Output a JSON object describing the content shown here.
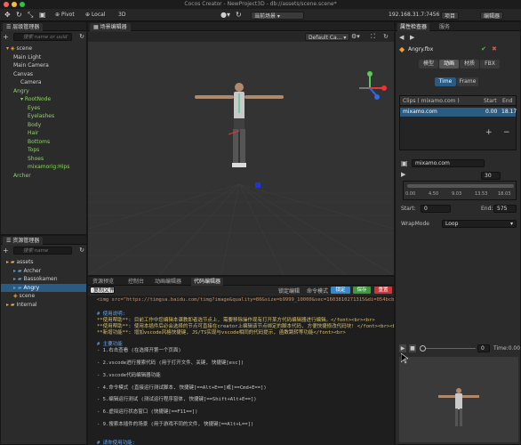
{
  "window": {
    "title": "Cocos Creator - NewProject3D - db://assets/scene.scene*"
  },
  "toolbar": {
    "pivot": "Pivot",
    "local": "Local",
    "mode3d": "3D",
    "scene_select": "当前场景",
    "ip": "192.168.31.7:7456",
    "project_btn": "项目",
    "editor_btn": "编辑器"
  },
  "hierarchy": {
    "tab": "层级管理器",
    "search_placeholder": "搜索 name or uuid",
    "nodes": [
      {
        "label": "scene",
        "depth": 0,
        "color": "normal"
      },
      {
        "label": "Main Light",
        "depth": 1,
        "color": "normal"
      },
      {
        "label": "Main Camera",
        "depth": 1,
        "color": "normal"
      },
      {
        "label": "Canvas",
        "depth": 1,
        "color": "normal"
      },
      {
        "label": "Camera",
        "depth": 2,
        "color": "normal"
      },
      {
        "label": "Angry",
        "depth": 1,
        "color": "green"
      },
      {
        "label": "RootNode",
        "depth": 2,
        "color": "green"
      },
      {
        "label": "Eyes",
        "depth": 3,
        "color": "green"
      },
      {
        "label": "Eyelashes",
        "depth": 3,
        "color": "green"
      },
      {
        "label": "Body",
        "depth": 3,
        "color": "green"
      },
      {
        "label": "Hair",
        "depth": 3,
        "color": "green"
      },
      {
        "label": "Bottoms",
        "depth": 3,
        "color": "green"
      },
      {
        "label": "Tops",
        "depth": 3,
        "color": "green"
      },
      {
        "label": "Shoes",
        "depth": 3,
        "color": "green"
      },
      {
        "label": "mixamorig:Hips",
        "depth": 3,
        "color": "green"
      },
      {
        "label": "Archer",
        "depth": 1,
        "color": "green"
      }
    ]
  },
  "assets": {
    "tab": "资源管理器",
    "search_placeholder": "搜索 name",
    "nodes": [
      {
        "label": "assets",
        "depth": 0,
        "sel": false
      },
      {
        "label": "Archer",
        "depth": 1,
        "sel": false
      },
      {
        "label": "Bassokamen",
        "depth": 1,
        "sel": false
      },
      {
        "label": "Angry",
        "depth": 1,
        "sel": true
      },
      {
        "label": "scene",
        "depth": 1,
        "sel": false
      },
      {
        "label": "Internal",
        "depth": 0,
        "sel": false
      }
    ]
  },
  "scene": {
    "tab": "场景编辑器",
    "camera_select": "Default Ca..."
  },
  "bottom": {
    "tabs": [
      "资源预览",
      "控制台",
      "动画编辑器",
      "代码编辑器"
    ],
    "file_select": "复制文件",
    "lock_label": "锁定编辑",
    "mode_label": "命令模式",
    "btn_save": "保存",
    "btn_run": "刷新",
    "btn_close": "重置",
    "code_lines": [
      "<img src=\"https://timgsa.baidu.com/timg?image&quality=80&size=b9999_10000&sec=1603810271315&di=054bcb72cf7f0fa1a0e0",
      "",
      "# 使用说明:",
      "**使用帮助**: 目前工作中您编辑本课教即者选节点上, 需要移除操作现有打开某方代码编辑器进行编辑。</font><br><br>",
      "**使用帮助**: 使用本插件后必会选择的节点可直接在creator上编辑该节点绑定的脚本代码, 方便快捷修改代码块! </font><br><br>",
      "**新增功能**: 增加vscode风格快捷键, JS/TS实现与vscode相同的代码提示, 函数跳转等功能</font><br>",
      "",
      "# 主要功能",
      "- 1.右击查看 (在选择开第一个页面)",
      "",
      "- 2.vscode进行搜索代码 (用于打开文件、关键, 快捷键[esc])",
      "",
      "- 3.vscode代码编辑器功能",
      "",
      "- 4.命令模式 (直接运行测试脚本, 快捷键[==Alt+E==]或[==Cmd+E==])",
      "",
      "- 5.编辑运行测试 (测试运行程序窗体, 快捷键[==Shift+Alt+E==])",
      "",
      "- 6.虚拟运行状态窗口 (快捷键[==F11==])",
      "",
      "- 9.搜索本插件的场景 (用于游戏不同的文件, 快捷键[==Alt+L==])",
      "",
      "",
      "# 请你使用功能:"
    ]
  },
  "inspector": {
    "tabs": [
      "属性检查器",
      "服务"
    ],
    "asset_name": "Angry.fbx",
    "sub_tabs": [
      "模型",
      "动画",
      "材质",
      "FBX"
    ],
    "active_sub_tab": "动画",
    "time_btn": "Time",
    "frame_btn": "Frame",
    "clips_header": "Clips ( mixamo.com )",
    "start_header": "Start",
    "end_header": "End",
    "clip_name": "mixamo.com",
    "clip_start": "0.00",
    "clip_end": "18.17",
    "add_btn": "+",
    "remove_btn": "−",
    "clip_field": "mixamo.com",
    "fps_value": "30",
    "timeline_ticks": [
      "0.00",
      "4.50",
      "9.03",
      "13.53",
      "18.03"
    ],
    "start_label": "Start:",
    "start_value": "0",
    "end_label": "End:",
    "end_value": "575",
    "wrapmode_label": "WrapMode",
    "wrapmode_value": "Loop",
    "preview_field": "0",
    "preview_time": "Time:0.00"
  },
  "colors": {
    "accent": "#2a5b82",
    "green_text": "#8fd16a",
    "save_btn": "#3c9a3c",
    "close_btn": "#c43b3b",
    "lock_btn": "#3a88c8"
  }
}
